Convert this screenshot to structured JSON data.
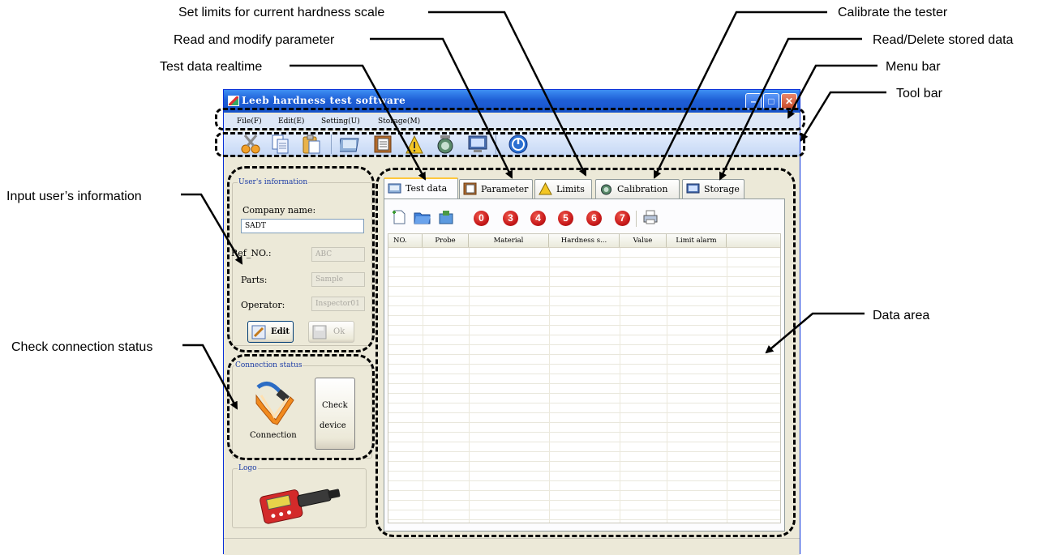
{
  "callouts": {
    "set_limits": "Set limits for current hardness scale",
    "calibrate": "Calibrate the tester",
    "read_modify": "Read and modify parameter",
    "read_delete": "Read/Delete stored data",
    "test_realtime": "Test data realtime",
    "menu_bar": "Menu bar",
    "tool_bar": "Tool bar",
    "input_user": "Input user’s information",
    "data_area": "Data area",
    "check_conn": "Check connection status"
  },
  "window": {
    "title": "Leeb hardness test software",
    "minimize": "–",
    "maximize": "□",
    "close": "✕"
  },
  "menu": [
    "File(F)",
    "Edit(E)",
    "Setting(U)",
    "Storage(M)"
  ],
  "toolbar_icons": [
    "cut-icon",
    "copy-icon",
    "paste-icon",
    "test-data-icon",
    "parameter-icon",
    "limits-icon",
    "calibration-icon",
    "storage-icon",
    "power-icon"
  ],
  "user_info": {
    "legend": "User's information",
    "company_label": "Company name:",
    "company_value": "SADT",
    "ref_label": "Ref_NO.:",
    "ref_value": "ABC",
    "parts_label": "Parts:",
    "parts_value": "Sample",
    "operator_label": "Operator:",
    "operator_value": "Inspector01",
    "edit_label": "Edit",
    "ok_label": "Ok"
  },
  "connection": {
    "legend": "Connection status",
    "status_label": "Connection",
    "check_line1": "Check",
    "check_line2": "device"
  },
  "logo": {
    "legend": "Logo"
  },
  "tabs": [
    "Test data",
    "Parameter",
    "Limits",
    "Calibration",
    "Storage"
  ],
  "data_toolbar": {
    "circles": [
      "0",
      "3",
      "4",
      "5",
      "6",
      "7"
    ]
  },
  "grid": {
    "columns": [
      "NO.",
      "Probe",
      "Material",
      "Hardness s...",
      "Value",
      "Limit alarm"
    ],
    "rows": []
  }
}
